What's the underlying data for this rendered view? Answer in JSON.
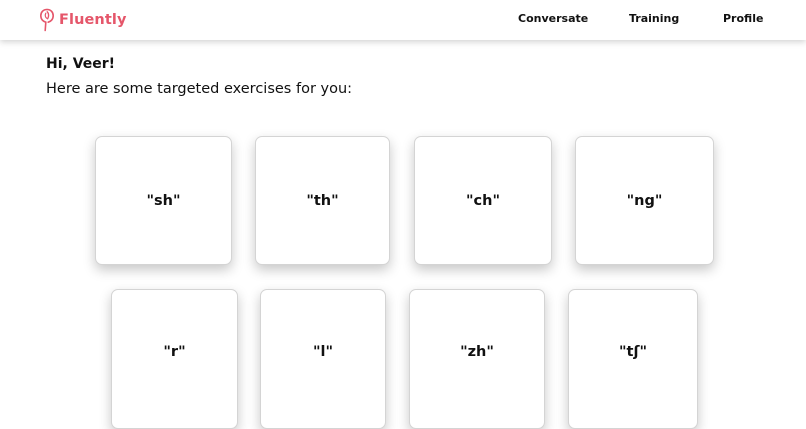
{
  "brand": {
    "name": "Fluently",
    "color": "#e5566a",
    "icon": "fluently-logo-icon"
  },
  "nav": {
    "items": [
      {
        "label": "Conversate"
      },
      {
        "label": "Training"
      },
      {
        "label": "Profile"
      }
    ]
  },
  "main": {
    "greeting": "Hi, Veer!",
    "subtitle": "Here are some targeted exercises for you:",
    "exercises": [
      {
        "label": "\"sh\""
      },
      {
        "label": "\"th\""
      },
      {
        "label": "\"ch\""
      },
      {
        "label": "\"ng\""
      },
      {
        "label": "\"r\""
      },
      {
        "label": "\"l\""
      },
      {
        "label": "\"zh\""
      },
      {
        "label": "\"tʃ\""
      }
    ]
  }
}
